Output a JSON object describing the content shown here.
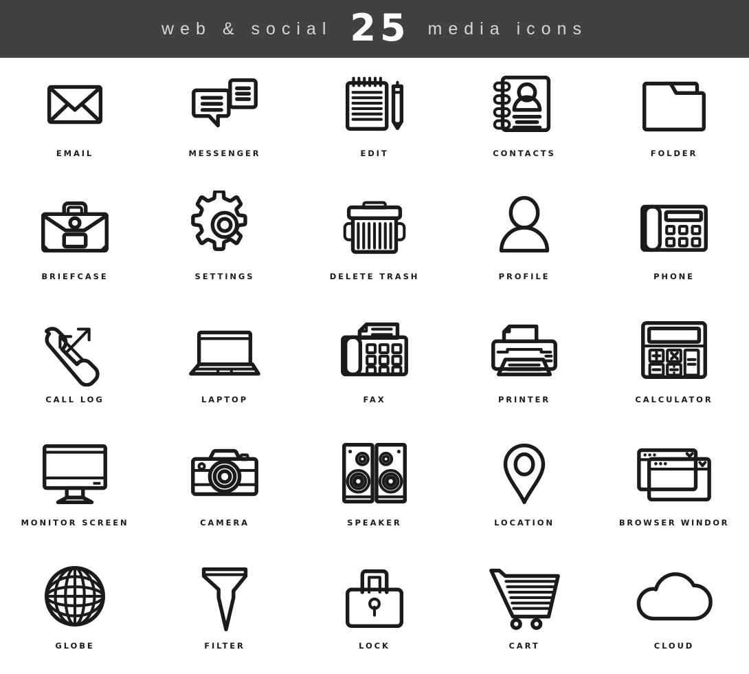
{
  "header": {
    "left_text": "web & social",
    "count": "25",
    "right_text": "media icons",
    "background_color": "#414042",
    "text_color": "#d7d7d8",
    "count_color": "#ffffff"
  },
  "page": {
    "background_color": "#ffffff",
    "icon_stroke_color": "#1b1b1b",
    "label_color": "#1b1b1b",
    "total_icons": 25,
    "columns": 5,
    "rows": 5
  },
  "icons": [
    {
      "label": "EMAIL",
      "icon": "envelope-icon"
    },
    {
      "label": "MESSENGER",
      "icon": "chat-bubbles-icon"
    },
    {
      "label": "EDIT",
      "icon": "notepad-pencil-icon"
    },
    {
      "label": "CONTACTS",
      "icon": "address-book-icon"
    },
    {
      "label": "FOLDER",
      "icon": "folder-icon"
    },
    {
      "label": "BRIEFCASE",
      "icon": "briefcase-icon"
    },
    {
      "label": "SETTINGS",
      "icon": "gear-icon"
    },
    {
      "label": "DELETE TRASH",
      "icon": "trash-can-icon"
    },
    {
      "label": "PROFILE",
      "icon": "user-avatar-icon"
    },
    {
      "label": "PHONE",
      "icon": "desk-phone-icon"
    },
    {
      "label": "CALL LOG",
      "icon": "handset-arrows-icon"
    },
    {
      "label": "LAPTOP",
      "icon": "laptop-icon"
    },
    {
      "label": "FAX",
      "icon": "fax-machine-icon"
    },
    {
      "label": "PRINTER",
      "icon": "printer-icon"
    },
    {
      "label": "CALCULATOR",
      "icon": "calculator-icon"
    },
    {
      "label": "MONITOR SCREEN",
      "icon": "monitor-icon"
    },
    {
      "label": "CAMERA",
      "icon": "camera-icon"
    },
    {
      "label": "SPEAKER",
      "icon": "speakers-icon"
    },
    {
      "label": "LOCATION",
      "icon": "map-pin-icon"
    },
    {
      "label": "BROWSER WINDOR",
      "icon": "browser-windows-icon"
    },
    {
      "label": "GLOBE",
      "icon": "globe-icon"
    },
    {
      "label": "FILTER",
      "icon": "funnel-icon"
    },
    {
      "label": "LOCK",
      "icon": "padlock-icon"
    },
    {
      "label": "CART",
      "icon": "shopping-cart-icon"
    },
    {
      "label": "CLOUD",
      "icon": "cloud-icon"
    }
  ]
}
